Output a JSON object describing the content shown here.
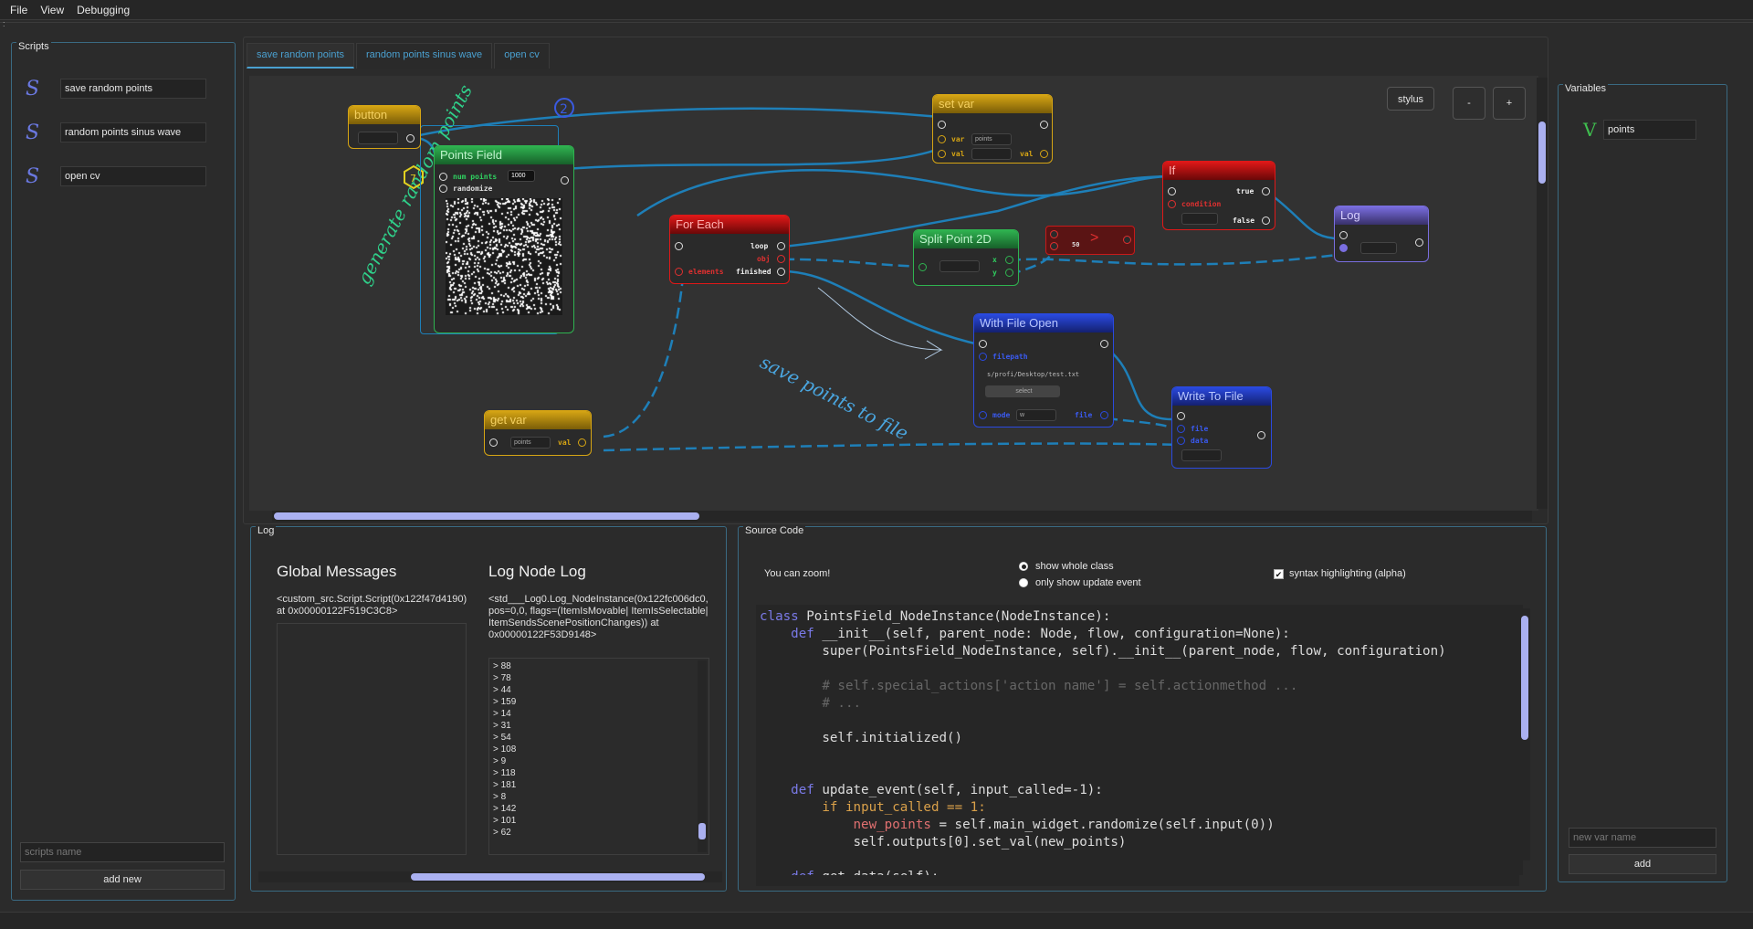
{
  "menu": [
    "File",
    "View",
    "Debugging"
  ],
  "scripts": {
    "title": "Scripts",
    "items": [
      {
        "label": "save random points",
        "icon": "script-icon"
      },
      {
        "label": "random points sinus wave",
        "icon": "script-icon"
      },
      {
        "label": "open cv",
        "icon": "script-icon"
      }
    ],
    "name_placeholder": "scripts name",
    "add_label": "add new"
  },
  "tabs": [
    "save random points",
    "random points sinus wave",
    "open cv"
  ],
  "canvas": {
    "stylus_label": "stylus",
    "zoom_out_label": "-",
    "zoom_in_label": "+",
    "annotations": {
      "generate": "generate random points",
      "save": "save points to file",
      "num2": "2",
      "num7": "7"
    },
    "nodes": {
      "button": {
        "title": "button"
      },
      "points_field": {
        "title": "Points Field",
        "num_points_label": "num points",
        "num_points_value": "1000",
        "randomize_label": "randomize"
      },
      "set_var": {
        "title": "set var",
        "var_label": "var",
        "var_value": "points",
        "val_label": "val",
        "val_out_label": "val"
      },
      "for_each": {
        "title": "For Each",
        "loop_label": "loop",
        "obj_label": "obj",
        "elements_label": "elements",
        "finished_label": "finished"
      },
      "split_point": {
        "title": "Split Point 2D",
        "x_label": "x",
        "y_label": "y"
      },
      "compare": {
        "title": ">",
        "value": "50"
      },
      "if": {
        "title": "If",
        "condition_label": "condition",
        "true_label": "true",
        "false_label": "false"
      },
      "log": {
        "title": "Log"
      },
      "with_file_open": {
        "title": "With File Open",
        "filepath_label": "filepath",
        "path_value": "s/profi/Desktop/test.txt",
        "select_label": "select",
        "mode_label": "mode",
        "mode_value": "w",
        "file_label": "file"
      },
      "write_to_file": {
        "title": "Write To File",
        "file_label": "file",
        "data_label": "data"
      },
      "get_var": {
        "title": "get var",
        "var_value": "points",
        "val_label": "val"
      }
    }
  },
  "log": {
    "title": "Log",
    "global_title": "Global Messages",
    "global_text": "<custom_src.Script.Script(0x122f47d4190) at 0x00000122F519C3C8>",
    "node_title": "Log Node Log",
    "node_text": "<std___Log0.Log_NodeInstance(0x122fc006dc0, pos=0,0, flags=(ItemIsMovable| ItemIsSelectable| ItemSendsScenePositionChanges)) at 0x00000122F53D9148>",
    "values": [
      "88",
      "78",
      "44",
      "159",
      "14",
      "31",
      "54",
      "108",
      "9",
      "118",
      "181",
      "8",
      "142",
      "101",
      "62"
    ]
  },
  "source": {
    "title": "Source Code",
    "zoom_hint": "You can zoom!",
    "opt_whole": "show whole class",
    "opt_update": "only show update event",
    "syntax_label": "syntax highlighting (alpha)"
  },
  "variables": {
    "title": "Variables",
    "items": [
      {
        "label": "points",
        "icon": "variable-icon"
      }
    ],
    "name_placeholder": "new var name",
    "add_label": "add"
  },
  "colors": {
    "button": "#d6a514",
    "points_field": "#2fb350",
    "set_var": "#d6a514",
    "for_each": "#e01818",
    "split_point": "#2fb350",
    "compare": "#c81a1a",
    "if": "#e01818",
    "log": "#7a6ee0",
    "with_file_open": "#2a4ae0",
    "write_to_file": "#2a4ae0",
    "get_var": "#d6a514"
  }
}
